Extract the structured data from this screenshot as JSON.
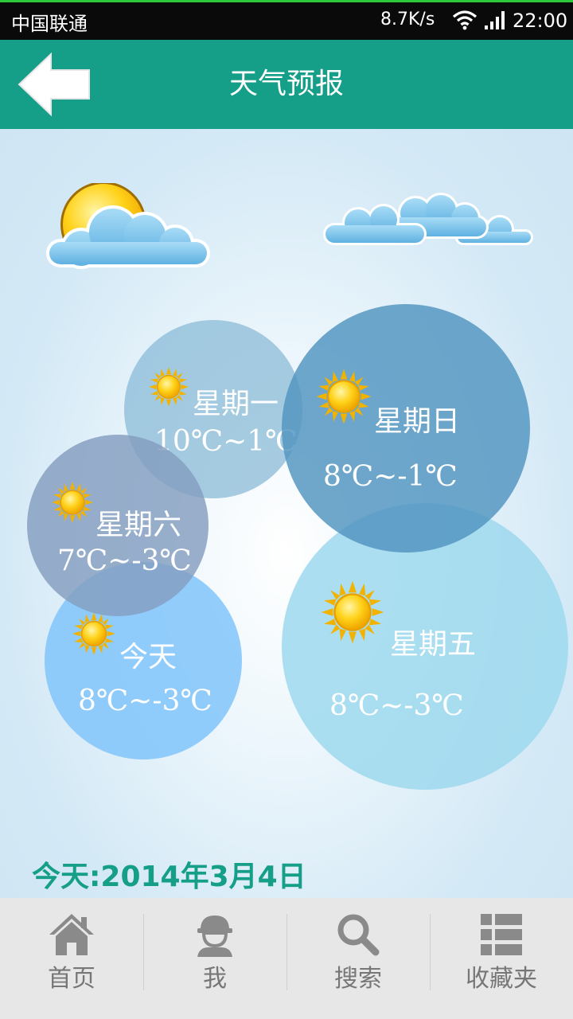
{
  "status_bar": {
    "carrier": "中国联通",
    "network_speed": "8.7K/s",
    "time": "22:00"
  },
  "header": {
    "title": "天气预报",
    "back_icon": "arrow-left-icon"
  },
  "forecast": [
    {
      "day": "星期一",
      "temp": "10℃~1℃",
      "icon": "sunny-icon",
      "color": "#9fc8df"
    },
    {
      "day": "星期日",
      "temp": "8℃~-1℃",
      "icon": "sunny-icon",
      "color": "#5c9ec7"
    },
    {
      "day": "星期六",
      "temp": "7℃~-3℃",
      "icon": "sunny-icon",
      "color": "#8ea8c6"
    },
    {
      "day": "今天",
      "temp": "8℃~-3℃",
      "icon": "sunny-icon",
      "color": "#8fcdfb"
    },
    {
      "day": "星期五",
      "temp": "8℃~-3℃",
      "icon": "sunny-icon",
      "color": "#a7dcef"
    }
  ],
  "date_line": "今天:2014年3月4日",
  "tabs": [
    {
      "label": "首页",
      "icon": "home-icon"
    },
    {
      "label": "我",
      "icon": "user-icon"
    },
    {
      "label": "搜索",
      "icon": "search-icon"
    },
    {
      "label": "收藏夹",
      "icon": "favorites-list-icon"
    }
  ],
  "colors": {
    "accent": "#159e88",
    "tab_text": "#777777",
    "tab_bg": "#e7e7e7"
  }
}
